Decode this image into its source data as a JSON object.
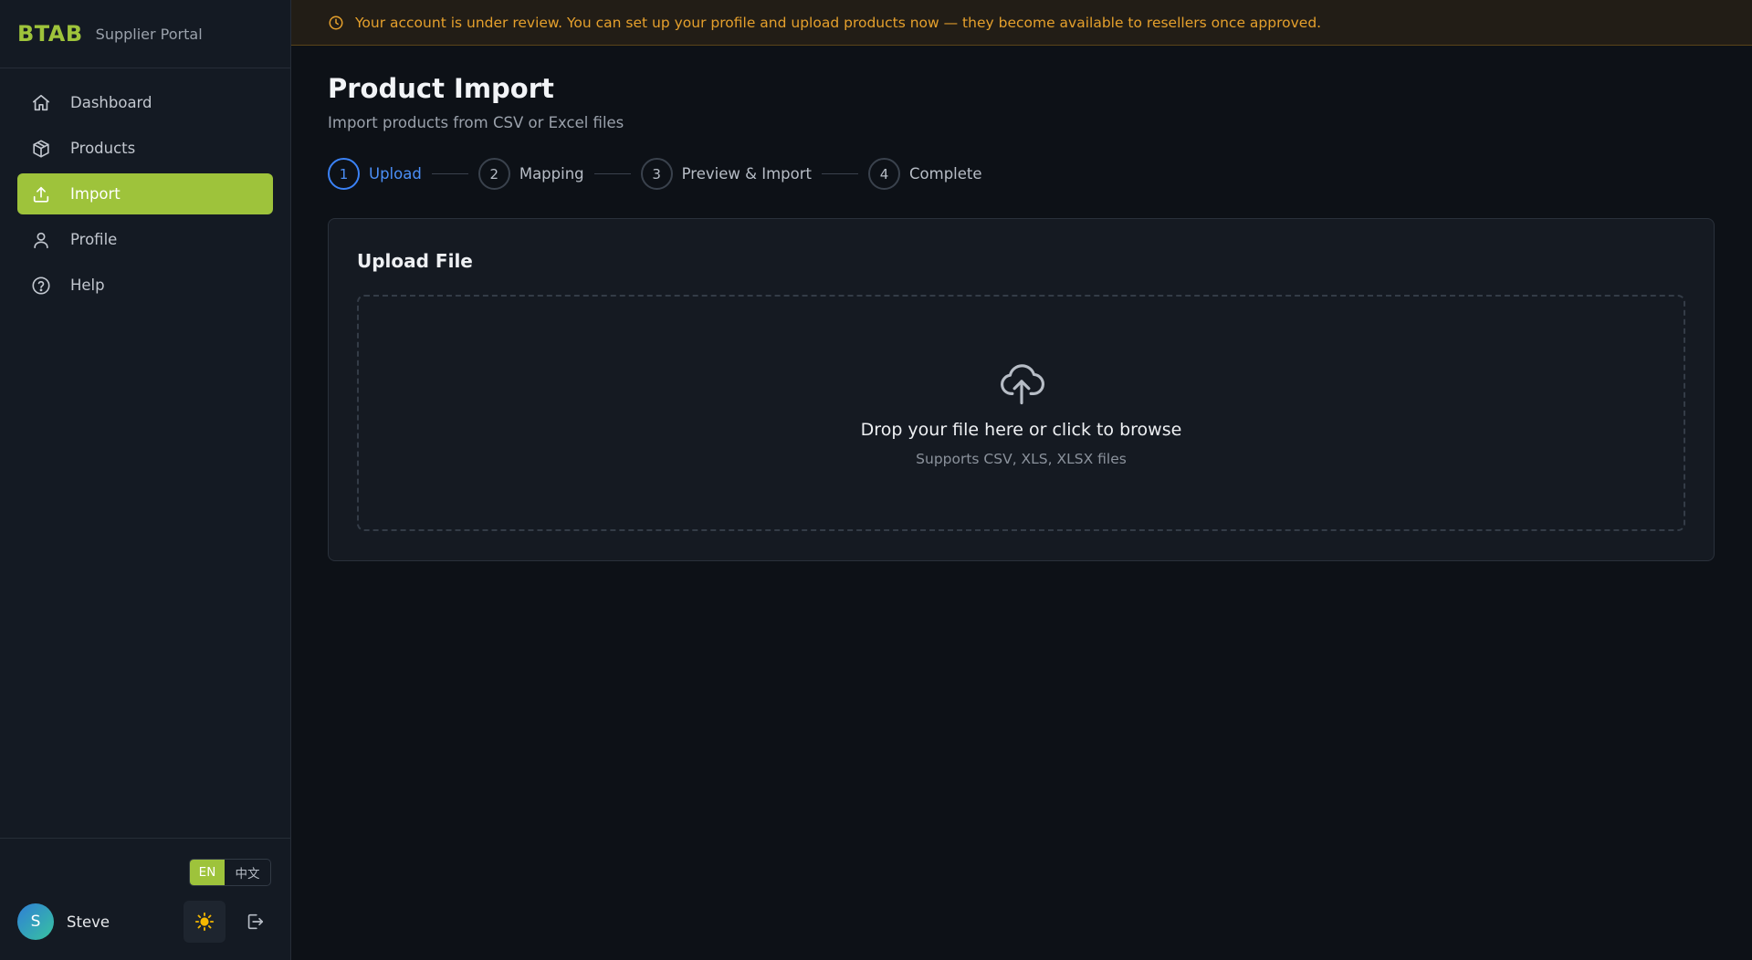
{
  "brand": {
    "logo": "BTAB",
    "subtitle": "Supplier Portal",
    "accent": "#9ec33b"
  },
  "sidebar": {
    "items": [
      {
        "label": "Dashboard",
        "icon": "home-icon",
        "active": false
      },
      {
        "label": "Products",
        "icon": "box-icon",
        "active": false
      },
      {
        "label": "Import",
        "icon": "upload-icon",
        "active": true
      },
      {
        "label": "Profile",
        "icon": "user-icon",
        "active": false
      },
      {
        "label": "Help",
        "icon": "help-circle-icon",
        "active": false
      }
    ]
  },
  "language": {
    "options": [
      "EN",
      "中文"
    ],
    "selected": "EN"
  },
  "user": {
    "initial": "S",
    "name": "Steve"
  },
  "banner": {
    "text": "Your account is under review. You can set up your profile and upload products now — they become available to resellers once approved.",
    "color": "#e5a02c",
    "icon": "clock-icon"
  },
  "page": {
    "title": "Product Import",
    "subtitle": "Import products from CSV or Excel files"
  },
  "steps": [
    {
      "num": "1",
      "label": "Upload",
      "active": true
    },
    {
      "num": "2",
      "label": "Mapping",
      "active": false
    },
    {
      "num": "3",
      "label": "Preview & Import",
      "active": false
    },
    {
      "num": "4",
      "label": "Complete",
      "active": false
    }
  ],
  "upload_card": {
    "title": "Upload File",
    "drop_text": "Drop your file here or click to browse",
    "supported_text": "Supports CSV, XLS, XLSX files",
    "icon": "cloud-upload-icon"
  }
}
